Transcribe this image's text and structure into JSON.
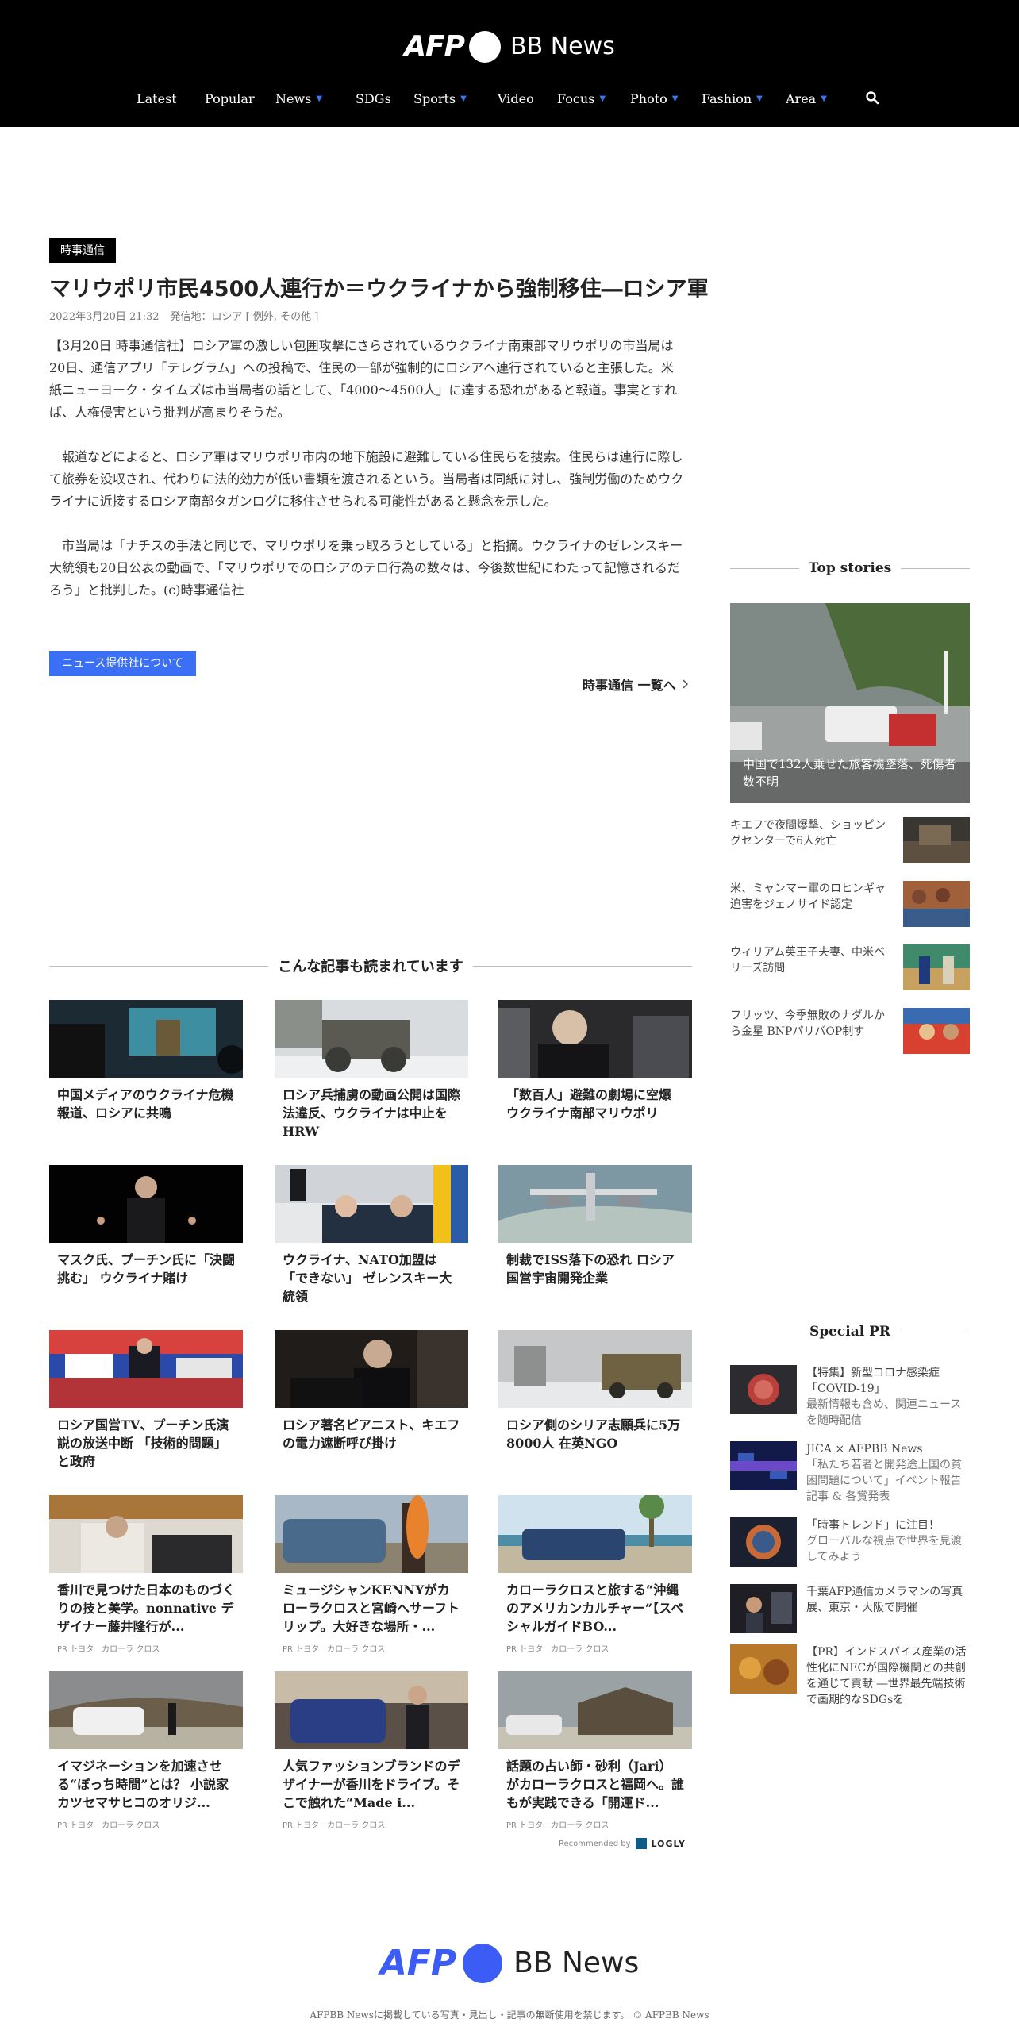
{
  "header": {
    "logo_afp": "AFP",
    "logo_bb": "BB News",
    "nav": [
      {
        "label": "Latest",
        "dropdown": false
      },
      {
        "label": "Popular",
        "dropdown": false
      },
      {
        "label": "News",
        "dropdown": true
      },
      {
        "label": "SDGs",
        "dropdown": false
      },
      {
        "label": "Sports",
        "dropdown": true
      },
      {
        "label": "Video",
        "dropdown": false
      },
      {
        "label": "Focus",
        "dropdown": true
      },
      {
        "label": "Photo",
        "dropdown": true
      },
      {
        "label": "Fashion",
        "dropdown": true
      },
      {
        "label": "Area",
        "dropdown": true
      }
    ],
    "search_icon": "search-icon"
  },
  "article": {
    "badge": "時事通信",
    "title": "マリウポリ市民4500人連行か＝ウクライナから強制移住―ロシア軍",
    "date": "2022年3月20日 21:32",
    "location": "発信地：ロシア [ 例外, その他 ]",
    "paragraphs": [
      "【3月20日 時事通信社】ロシア軍の激しい包囲攻撃にさらされているウクライナ南東部マリウポリの市当局は20日、通信アプリ「テレグラム」への投稿で、住民の一部が強制的にロシアへ連行されていると主張した。米紙ニューヨーク・タイムズは市当局者の話として、「4000～4500人」に達する恐れがあると報道。事実とすれば、人権侵害という批判が高まりそうだ。",
      "　報道などによると、ロシア軍はマリウポリ市内の地下施設に避難している住民らを捜索。住民らは連行に際して旅券を没収され、代わりに法的効力が低い書類を渡されるという。当局者は同紙に対し、強制労働のためウクライナに近接するロシア南部タガンログに移住させられる可能性があると懸念を示した。",
      "　市当局は「ナチスの手法と同じで、マリウポリを乗っ取ろうとしている」と指摘。ウクライナのゼレンスキー大統領も20日公表の動画で、「マリウポリでのロシアのテロ行為の数々は、今後数世紀にわたって記憶されるだろう」と批判した。(c)時事通信社"
    ],
    "provider_button": "ニュース提供社について",
    "more_link": "時事通信 一覧へ"
  },
  "recommended": {
    "heading": "こんな記事も読まれています",
    "cards": [
      {
        "title": "中国メディアのウクライナ危機報道、ロシアに共鳴",
        "pr": ""
      },
      {
        "title": "ロシア兵捕虜の動画公開は国際法違反、ウクライナは中止を HRW",
        "pr": ""
      },
      {
        "title": "「数百人」避難の劇場に空爆 ウクライナ南部マリウポリ",
        "pr": ""
      },
      {
        "title": "マスク氏、プーチン氏に「決闘挑む」 ウクライナ賭け",
        "pr": ""
      },
      {
        "title": "ウクライナ、NATO加盟は「できない」 ゼレンスキー大統領",
        "pr": ""
      },
      {
        "title": "制裁でISS落下の恐れ ロシア国営宇宙開発企業",
        "pr": ""
      },
      {
        "title": "ロシア国営TV、プーチン氏演説の放送中断 「技術的問題」と政府",
        "pr": ""
      },
      {
        "title": "ロシア著名ピアニスト、キエフの電力遮断呼び掛け",
        "pr": ""
      },
      {
        "title": "ロシア側のシリア志願兵に5万8000人 在英NGO",
        "pr": ""
      },
      {
        "title": "香川で見つけた日本のものづくりの技と美学。nonnative デザイナー藤井隆行が...",
        "pr": "PR トヨタ　カローラ クロス"
      },
      {
        "title": "ミュージシャンKENNYがカローラクロスと宮崎へサーフトリップ。大好きな場所・...",
        "pr": "PR トヨタ　カローラ クロス"
      },
      {
        "title": "カローラクロスと旅する“沖縄のアメリカンカルチャー”【スペシャルガイドBO...",
        "pr": "PR トヨタ　カローラ クロス"
      },
      {
        "title": "イマジネーションを加速させる“ぼっち時間”とは？ 小説家カツセマサヒコのオリジ...",
        "pr": "PR トヨタ　カローラ クロス"
      },
      {
        "title": "人気ファッションブランドのデザイナーが香川をドライブ。そこで触れた“Made i...",
        "pr": "PR トヨタ　カローラ クロス"
      },
      {
        "title": "話題の占い師・砂利（Jari）がカローラクロスと福岡へ。誰もが実践できる「開運ド...",
        "pr": "PR トヨタ　カローラ クロス"
      }
    ],
    "recommended_by": "Recommended by",
    "logly": "LOGLY"
  },
  "sidebar": {
    "top_stories_heading": "Top stories",
    "hero_caption": "中国で132人乗せた旅客機墜落、死傷者数不明",
    "items": [
      {
        "title": "キエフで夜間爆撃、ショッピングセンターで6人死亡"
      },
      {
        "title": "米、ミャンマー軍のロヒンギャ迫害をジェノサイド認定"
      },
      {
        "title": "ウィリアム英王子夫妻、中米ベリーズ訪問"
      },
      {
        "title": "フリッツ、今季無敗のナダルから金星 BNPパリバOP制す"
      }
    ],
    "special_pr_heading": "Special PR",
    "pr_items": [
      {
        "title": "【特集】新型コロナ感染症「COVID-19」",
        "sub": "最新情報も含め、関連ニュースを随時配信"
      },
      {
        "title": "JICA × AFPBB News",
        "sub": "「私たち若者と開発途上国の貧困問題について」イベント報告記事 & 各賞発表"
      },
      {
        "title": "「時事トレンド」に注目！",
        "sub": "グローバルな視点で世界を見渡してみよう"
      },
      {
        "title": "千葉AFP通信カメラマンの写真展、東京・大阪で開催",
        "sub": ""
      },
      {
        "title": "【PR】インドスパイス産業の活性化にNECが国際機関との共創を通じて貢献 ―世界最先端技術で画期的なSDGsを",
        "sub": ""
      }
    ]
  },
  "footer": {
    "logo_afp": "AFP",
    "logo_bb": "BB News",
    "copyright": "AFPBB Newsに掲載している写真・見出し・記事の無断使用を禁じます。 © AFPBB News"
  },
  "colors": {
    "header_bg": "#000000",
    "accent_blue": "#3b6ff5",
    "footer_logo_blue": "#3b5cf5"
  }
}
